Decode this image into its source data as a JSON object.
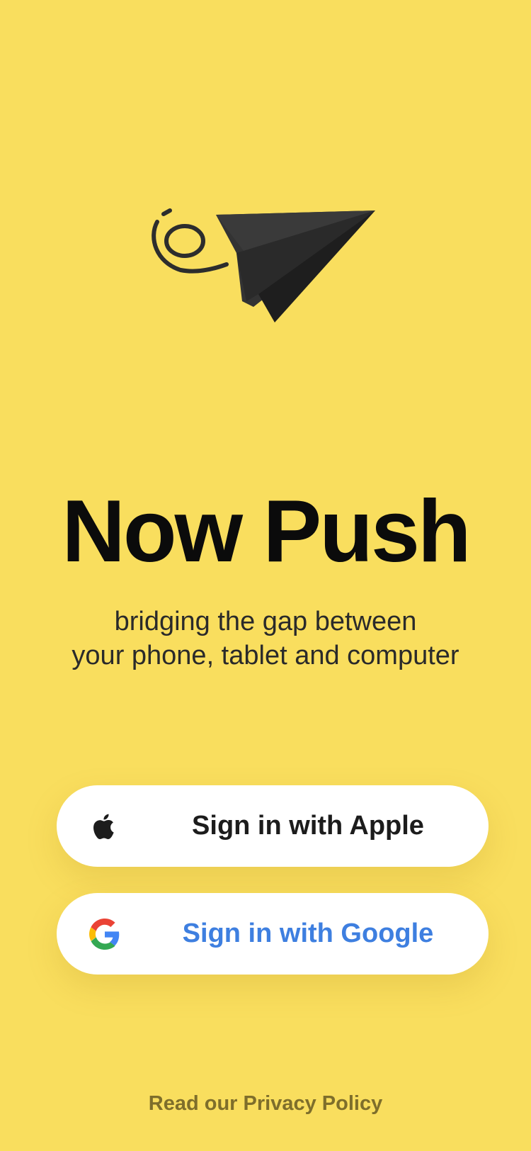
{
  "app": {
    "title": "Now Push",
    "tagline_line1": "bridging the gap between",
    "tagline_line2": "your phone, tablet and computer",
    "logo_icon": "paper-plane-icon"
  },
  "buttons": {
    "apple_label": "Sign in with Apple",
    "apple_icon": "apple-icon",
    "google_label": "Sign in with Google",
    "google_icon": "google-icon"
  },
  "footer": {
    "privacy_link": "Read our Privacy Policy"
  },
  "colors": {
    "background": "#F9DE5E",
    "button_background": "#FFFFFF",
    "title_text": "#0B0B0B",
    "google_label": "#3E7FE0",
    "privacy_link": "#7E6E2B"
  }
}
